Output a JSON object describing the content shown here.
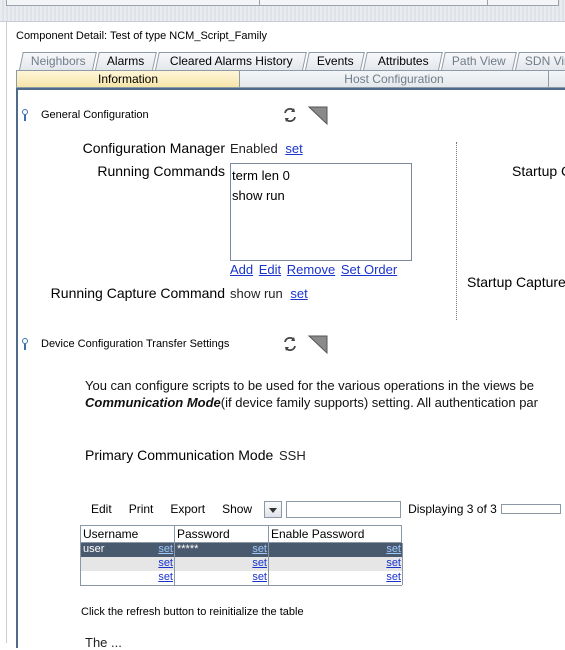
{
  "window": {
    "title": "Component Detail: Test of type NCM_Script_Family"
  },
  "tabs": [
    {
      "label": "Neighbors",
      "state": "dim"
    },
    {
      "label": "Alarms",
      "state": "normal"
    },
    {
      "label": "Cleared Alarms History",
      "state": "normal"
    },
    {
      "label": "Events",
      "state": "normal"
    },
    {
      "label": "Attributes",
      "state": "normal"
    },
    {
      "label": "Path View",
      "state": "dim"
    },
    {
      "label": "SDN Virtu",
      "state": "dim"
    }
  ],
  "subtabs": [
    {
      "label": "Information",
      "active": true
    },
    {
      "label": "Host Configuration",
      "active": false
    }
  ],
  "general": {
    "header": "General Configuration",
    "config_manager_label": "Configuration Manager",
    "config_manager_value": "Enabled",
    "set_label": "set",
    "running_commands_label": "Running Commands",
    "running_commands": [
      "term len 0",
      "show run"
    ],
    "cmd_actions": [
      "Add",
      "Edit",
      "Remove",
      "Set Order"
    ],
    "capture_label": "Running Capture Command",
    "capture_value": "show run",
    "startup_label": "Startup C",
    "startup_capture_label": "Startup Capture"
  },
  "transfer": {
    "header": "Device Configuration Transfer Settings",
    "desc_line1": "You can configure scripts to be used for the various operations in the views be",
    "desc_bold": "Communication Mode",
    "desc_line2_rest": "(if device family supports) setting. All authentication par",
    "primary_label": "Primary Communication Mode",
    "primary_value": "SSH"
  },
  "toolbar": {
    "edit": "Edit",
    "print": "Print",
    "export": "Export",
    "show": "Show",
    "displaying": "Displaying 3 of 3"
  },
  "table": {
    "columns": [
      "Username",
      "Password",
      "Enable Password"
    ],
    "rows": [
      {
        "username": "user",
        "password": "*****",
        "enable": "",
        "selected": true
      },
      {
        "username": "",
        "password": "",
        "enable": "",
        "selected": false
      },
      {
        "username": "",
        "password": "",
        "enable": "",
        "selected": false
      }
    ],
    "set_label": "set",
    "note": "Click the refresh button to reinitialize the table"
  },
  "footer_text": "The ..."
}
